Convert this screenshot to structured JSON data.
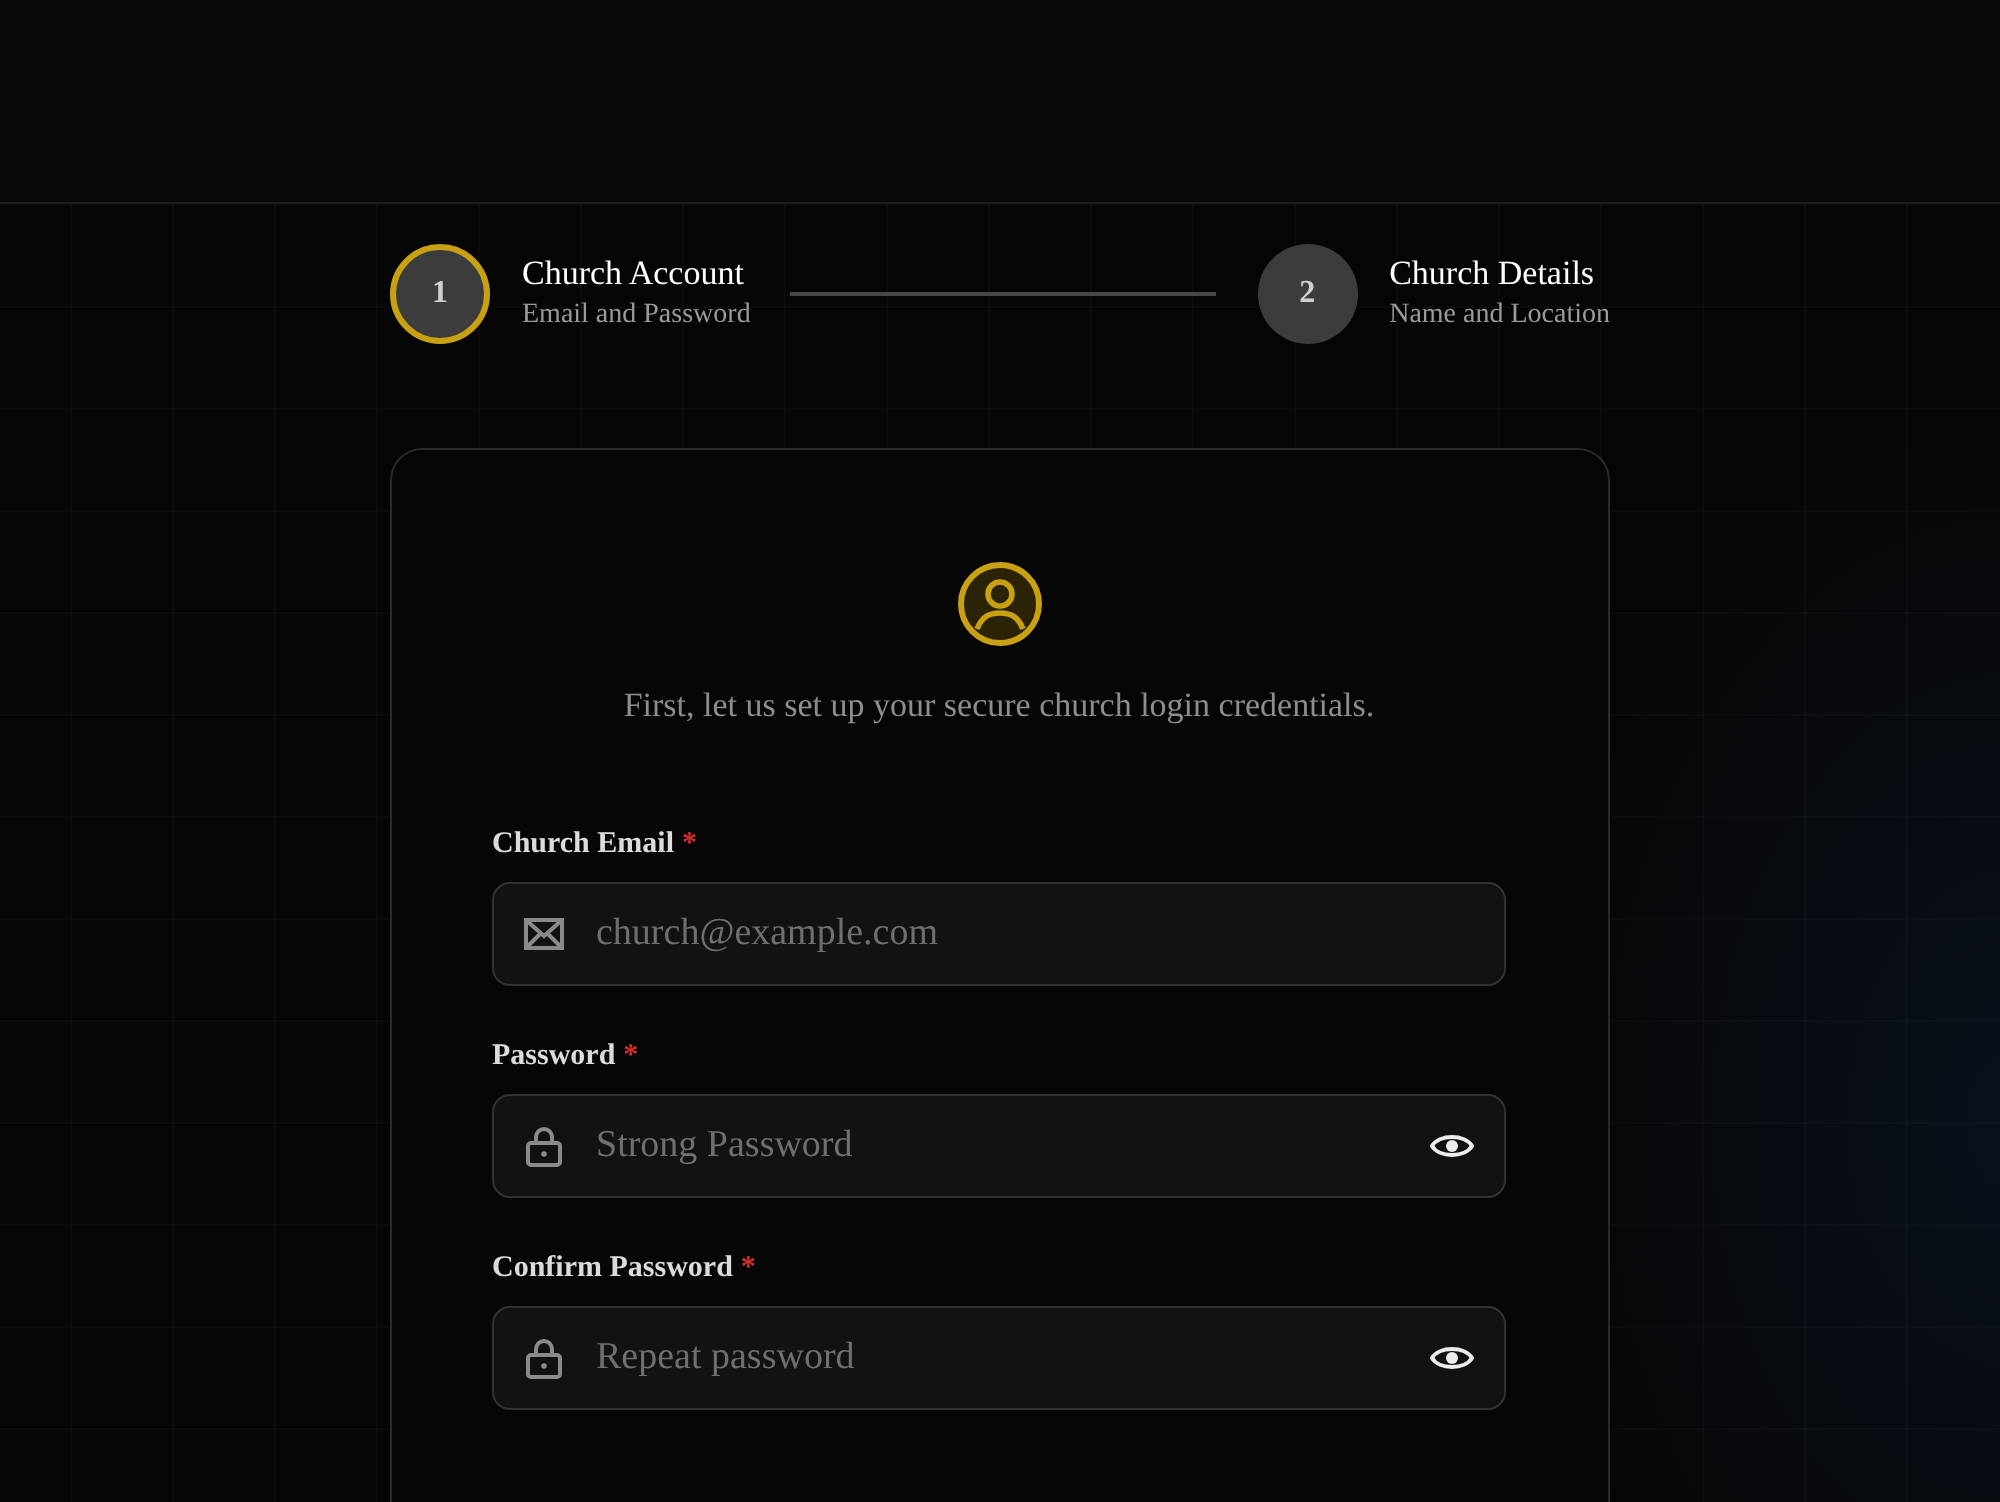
{
  "steps": [
    {
      "number": "1",
      "title": "Church Account",
      "subtitle": "Email and Password",
      "selected": true
    },
    {
      "number": "2",
      "title": "Church Details",
      "subtitle": "Name and Location",
      "selected": false
    }
  ],
  "card": {
    "intro": "First, let us set up your secure church login credentials.",
    "fields": [
      {
        "kind": "email",
        "label": "Church Email",
        "required_mark": "*",
        "placeholder": "church@example.com"
      },
      {
        "kind": "password",
        "label": "Password",
        "required_mark": "*",
        "placeholder": "Strong Password"
      },
      {
        "kind": "password",
        "label": "Confirm Password",
        "required_mark": "*",
        "placeholder": "Repeat password"
      }
    ]
  }
}
